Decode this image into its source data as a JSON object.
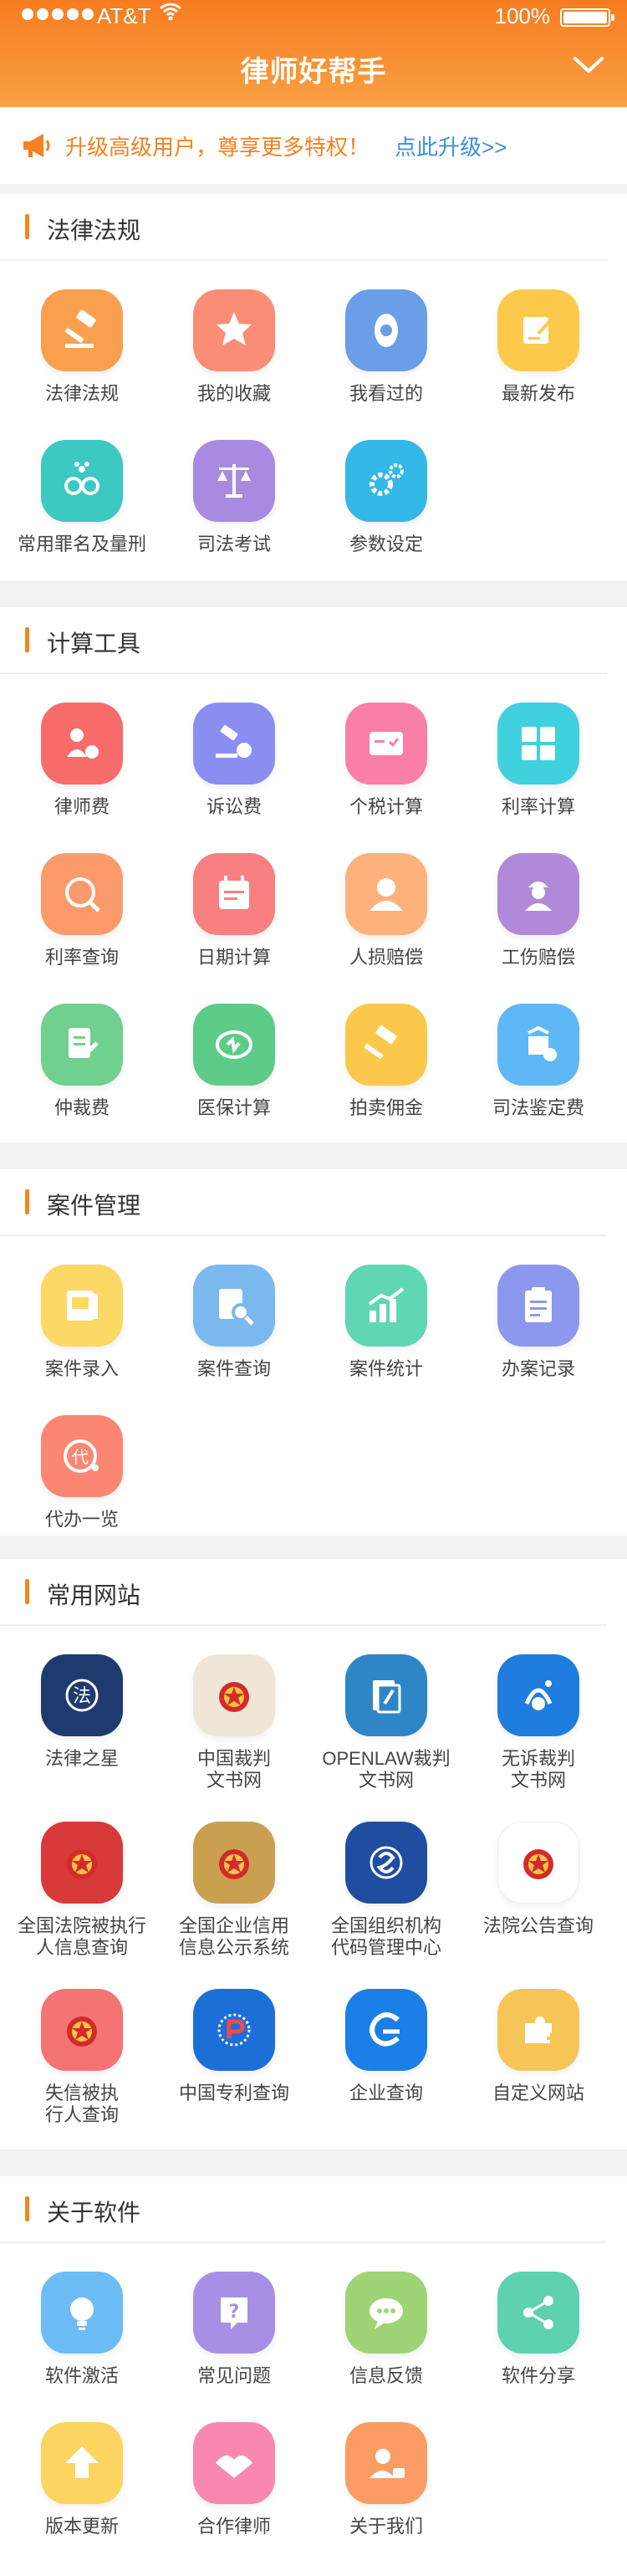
{
  "status_bar": {
    "carrier": "AT&T",
    "battery": "100%"
  },
  "header": {
    "title": "律师好帮手"
  },
  "banner": {
    "message": "升级高级用户，尊享更多特权！",
    "link": "点此升级>>"
  },
  "sections": [
    {
      "title": "法律法规",
      "items": [
        {
          "label": "法律法规",
          "color": "#f9a04e",
          "icon": "gavel-icon"
        },
        {
          "label": "我的收藏",
          "color": "#fb8d76",
          "icon": "star-icon"
        },
        {
          "label": "我看过的",
          "color": "#6a9ee8",
          "icon": "eye-icon"
        },
        {
          "label": "最新发布",
          "color": "#fcc94b",
          "icon": "edit-icon"
        },
        {
          "label": "常用罪名及量刑",
          "color": "#3cc9c4",
          "icon": "handcuffs-icon"
        },
        {
          "label": "司法考试",
          "color": "#a78be0",
          "icon": "scales-icon"
        },
        {
          "label": "参数设定",
          "color": "#33b8e8",
          "icon": "gear-icon"
        }
      ]
    },
    {
      "title": "计算工具",
      "items": [
        {
          "label": "律师费",
          "color": "#f76b6b",
          "icon": "lawyer-fee-icon"
        },
        {
          "label": "诉讼费",
          "color": "#8a8ef0",
          "icon": "lawsuit-fee-icon"
        },
        {
          "label": "个税计算",
          "color": "#f97fa8",
          "icon": "tax-icon"
        },
        {
          "label": "利率计算",
          "color": "#3fd1de",
          "icon": "calculator-icon"
        },
        {
          "label": "利率查询",
          "color": "#fb9a6b",
          "icon": "percent-icon"
        },
        {
          "label": "日期计算",
          "color": "#f98080",
          "icon": "calendar-icon"
        },
        {
          "label": "人损赔偿",
          "color": "#fcb27a",
          "icon": "person-icon"
        },
        {
          "label": "工伤赔偿",
          "color": "#b08ad8",
          "icon": "worker-icon"
        },
        {
          "label": "仲裁费",
          "color": "#6fd08f",
          "icon": "document-icon"
        },
        {
          "label": "医保计算",
          "color": "#5ccc88",
          "icon": "medical-icon"
        },
        {
          "label": "拍卖佣金",
          "color": "#fcc84c",
          "icon": "hammer-icon"
        },
        {
          "label": "司法鉴定费",
          "color": "#5eb8f5",
          "icon": "appraisal-icon"
        }
      ]
    },
    {
      "title": "案件管理",
      "items": [
        {
          "label": "案件录入",
          "color": "#fcd864",
          "icon": "case-entry-icon"
        },
        {
          "label": "案件查询",
          "color": "#7ab8ee",
          "icon": "case-search-icon"
        },
        {
          "label": "案件统计",
          "color": "#5fd6b4",
          "icon": "chart-icon"
        },
        {
          "label": "办案记录",
          "color": "#8c98ee",
          "icon": "clipboard-icon"
        },
        {
          "label": "代办一览",
          "color": "#fb8672",
          "icon": "agent-icon"
        }
      ]
    },
    {
      "title": "常用网站",
      "items": [
        {
          "label": "法律之星",
          "color": "#1e3a6e",
          "icon": "fa-logo-icon"
        },
        {
          "label": "中国裁判\n文书网",
          "color": "#efe6d8",
          "icon": "national-emblem-icon"
        },
        {
          "label": "OPENLAW裁判\n文书网",
          "color": "#2f86c6",
          "icon": "openlaw-logo-icon"
        },
        {
          "label": "无诉裁判\n文书网",
          "color": "#1f7de0",
          "icon": "wusu-logo-icon"
        },
        {
          "label": "全国法院被执行\n人信息查询",
          "color": "#d83a3a",
          "icon": "national-emblem-icon"
        },
        {
          "label": "全国企业信用\n信息公示系统",
          "color": "#c9a050",
          "icon": "national-emblem-icon"
        },
        {
          "label": "全国组织机构\n代码管理中心",
          "color": "#1f4ea0",
          "icon": "org-code-logo-icon"
        },
        {
          "label": "法院公告查询",
          "color": "#ffffff",
          "icon": "national-emblem-icon"
        },
        {
          "label": "失信被执\n行人查询",
          "color": "#f47474",
          "icon": "national-emblem-icon"
        },
        {
          "label": "中国专利查询",
          "color": "#1d6fd8",
          "icon": "patent-logo-icon"
        },
        {
          "label": "企业查询",
          "color": "#1a80e8",
          "icon": "enterprise-logo-icon"
        },
        {
          "label": "自定义网站",
          "color": "#f5c558",
          "icon": "puzzle-icon"
        }
      ]
    },
    {
      "title": "关于软件",
      "items": [
        {
          "label": "软件激活",
          "color": "#6cbcf5",
          "icon": "bulb-icon"
        },
        {
          "label": "常见问题",
          "color": "#a88fe6",
          "icon": "question-icon"
        },
        {
          "label": "信息反馈",
          "color": "#9fd476",
          "icon": "chat-icon"
        },
        {
          "label": "软件分享",
          "color": "#5dd1b0",
          "icon": "share-icon"
        },
        {
          "label": "版本更新",
          "color": "#fcd460",
          "icon": "upload-icon"
        },
        {
          "label": "合作律师",
          "color": "#f988b0",
          "icon": "handshake-icon"
        },
        {
          "label": "关于我们",
          "color": "#fb9c64",
          "icon": "about-icon"
        }
      ]
    }
  ]
}
